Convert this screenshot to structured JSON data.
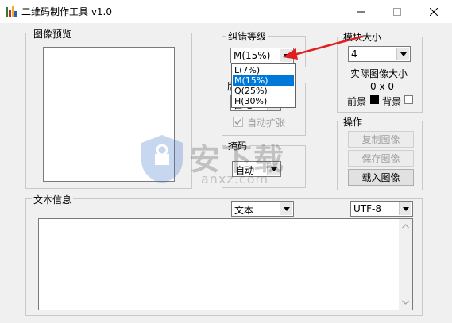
{
  "window": {
    "title": "二维码制作工具 v1.0",
    "minimize": "—",
    "maximize": "☐",
    "close": "✕"
  },
  "preview": {
    "label": "图像预览"
  },
  "error_correction": {
    "label": "纠错等级",
    "selected": "M(15%)",
    "options": [
      "L(7%)",
      "M(15%)",
      "Q(25%)",
      "H(30%)"
    ],
    "highlighted_index": 1
  },
  "version": {
    "label_partial": "版",
    "value_partial": "自动",
    "auto_expand_label": "自动扩张"
  },
  "mask": {
    "label": "掩码",
    "selected": "自动"
  },
  "module_size": {
    "label": "模块大小",
    "selected": "4",
    "actual_size_label": "实际图像大小",
    "actual_size_value": "0 x 0",
    "foreground_label": "前景",
    "background_label": "背景",
    "foreground_color": "#000000",
    "background_color": "#ffffff"
  },
  "operations": {
    "label": "操作",
    "copy_image": "复制图像",
    "save_image": "保存图像",
    "load_image": "载入图像"
  },
  "text_info": {
    "label": "文本信息",
    "type_selected": "文本",
    "encoding_selected": "UTF-8",
    "content": ""
  },
  "watermark": {
    "text_main": "安下载",
    "text_sub": "anxz.com"
  },
  "colors": {
    "selection": "#0078d7",
    "arrow": "#e02020"
  }
}
